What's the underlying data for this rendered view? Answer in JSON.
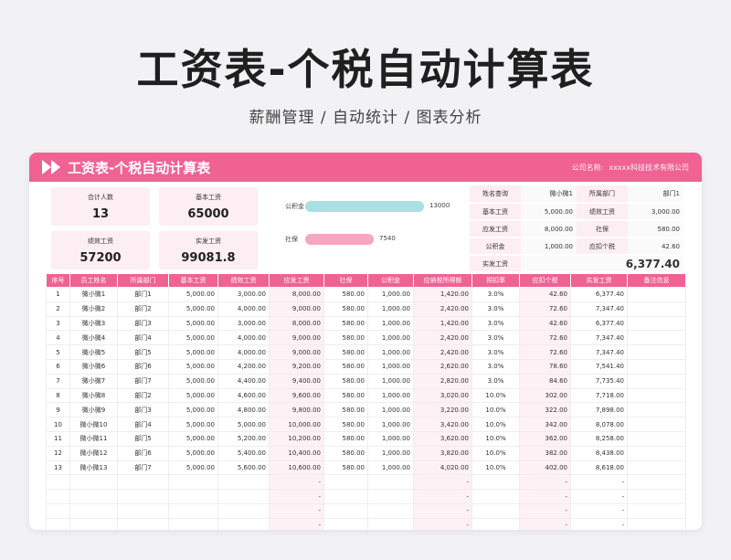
{
  "hero": {
    "title": "工资表-个税自动计算表",
    "subtitle": "薪酬管理 / 自动统计 / 图表分析"
  },
  "header": {
    "title": "工资表-个税自动计算表",
    "company_label": "公司名称:",
    "company_name": "xxxxx科技技术有限公司"
  },
  "summary": [
    {
      "label": "合计人数",
      "value": "13"
    },
    {
      "label": "基本工资",
      "value": "65000"
    },
    {
      "label": "绩效工资",
      "value": "57200"
    },
    {
      "label": "实发工资",
      "value": "99081.8"
    }
  ],
  "bars": [
    {
      "label": "公积金",
      "value": 13000,
      "value_text": "13000",
      "color": "#a8e0e4"
    },
    {
      "label": "社保",
      "value": 7540,
      "value_text": "7540",
      "color": "#f8a5c2"
    }
  ],
  "lookup": {
    "rows": [
      [
        "姓名查询",
        "微小微1",
        "所属部门",
        "部门1"
      ],
      [
        "基本工资",
        "5,000.00",
        "绩效工资",
        "3,000.00"
      ],
      [
        "应发工资",
        "8,000.00",
        "社保",
        "580.00"
      ],
      [
        "公积金",
        "1,000.00",
        "应扣个税",
        "42.60"
      ]
    ],
    "total_label": "实发工资",
    "total_value": "6,377.40"
  },
  "table": {
    "columns": [
      "序号",
      "员工姓名",
      "所属部门",
      "基本工资",
      "绩效工资",
      "应发工资",
      "社保",
      "公积金",
      "应纳税所得额",
      "预扣率",
      "应扣个税",
      "实发工资",
      "备注信息"
    ],
    "rows": [
      [
        "1",
        "微小微1",
        "部门1",
        "5,000.00",
        "3,000.00",
        "8,000.00",
        "580.00",
        "1,000.00",
        "1,420.00",
        "3.0%",
        "42.60",
        "6,377.40",
        ""
      ],
      [
        "2",
        "微小微2",
        "部门2",
        "5,000.00",
        "4,000.00",
        "9,000.00",
        "580.00",
        "1,000.00",
        "2,420.00",
        "3.0%",
        "72.60",
        "7,347.40",
        ""
      ],
      [
        "3",
        "微小微3",
        "部门3",
        "5,000.00",
        "3,000.00",
        "8,000.00",
        "580.00",
        "1,000.00",
        "1,420.00",
        "3.0%",
        "42.60",
        "6,377.40",
        ""
      ],
      [
        "4",
        "微小微4",
        "部门4",
        "5,000.00",
        "4,000.00",
        "9,000.00",
        "580.00",
        "1,000.00",
        "2,420.00",
        "3.0%",
        "72.60",
        "7,347.40",
        ""
      ],
      [
        "5",
        "微小微5",
        "部门5",
        "5,000.00",
        "4,000.00",
        "9,000.00",
        "580.00",
        "1,000.00",
        "2,420.00",
        "3.0%",
        "72.60",
        "7,347.40",
        ""
      ],
      [
        "6",
        "微小微6",
        "部门6",
        "5,000.00",
        "4,200.00",
        "9,200.00",
        "580.00",
        "1,000.00",
        "2,620.00",
        "3.0%",
        "78.60",
        "7,541.40",
        ""
      ],
      [
        "7",
        "微小微7",
        "部门7",
        "5,000.00",
        "4,400.00",
        "9,400.00",
        "580.00",
        "1,000.00",
        "2,820.00",
        "3.0%",
        "84.60",
        "7,735.40",
        ""
      ],
      [
        "8",
        "微小微8",
        "部门2",
        "5,000.00",
        "4,600.00",
        "9,600.00",
        "580.00",
        "1,000.00",
        "3,020.00",
        "10.0%",
        "302.00",
        "7,718.00",
        ""
      ],
      [
        "9",
        "微小微9",
        "部门3",
        "5,000.00",
        "4,800.00",
        "9,800.00",
        "580.00",
        "1,000.00",
        "3,220.00",
        "10.0%",
        "322.00",
        "7,898.00",
        ""
      ],
      [
        "10",
        "微小微10",
        "部门4",
        "5,000.00",
        "5,000.00",
        "10,000.00",
        "580.00",
        "1,000.00",
        "3,420.00",
        "10.0%",
        "342.00",
        "8,078.00",
        ""
      ],
      [
        "11",
        "微小微11",
        "部门5",
        "5,000.00",
        "5,200.00",
        "10,200.00",
        "580.00",
        "1,000.00",
        "3,620.00",
        "10.0%",
        "362.00",
        "8,258.00",
        ""
      ],
      [
        "12",
        "微小微12",
        "部门6",
        "5,000.00",
        "5,400.00",
        "10,400.00",
        "580.00",
        "1,000.00",
        "3,820.00",
        "10.0%",
        "382.00",
        "8,438.00",
        ""
      ],
      [
        "13",
        "微小微13",
        "部门7",
        "5,000.00",
        "5,600.00",
        "10,600.00",
        "580.00",
        "1,000.00",
        "4,020.00",
        "10.0%",
        "402.00",
        "8,618.00",
        ""
      ],
      [
        "",
        "",
        "",
        "",
        "",
        "-",
        "",
        "",
        "-",
        "",
        "-",
        "-",
        ""
      ],
      [
        "",
        "",
        "",
        "",
        "",
        "-",
        "",
        "",
        "-",
        "",
        "-",
        "-",
        ""
      ],
      [
        "",
        "",
        "",
        "",
        "",
        "-",
        "",
        "",
        "-",
        "",
        "-",
        "-",
        ""
      ],
      [
        "",
        "",
        "",
        "",
        "",
        "-",
        "",
        "",
        "-",
        "",
        "-",
        "-",
        ""
      ]
    ]
  }
}
